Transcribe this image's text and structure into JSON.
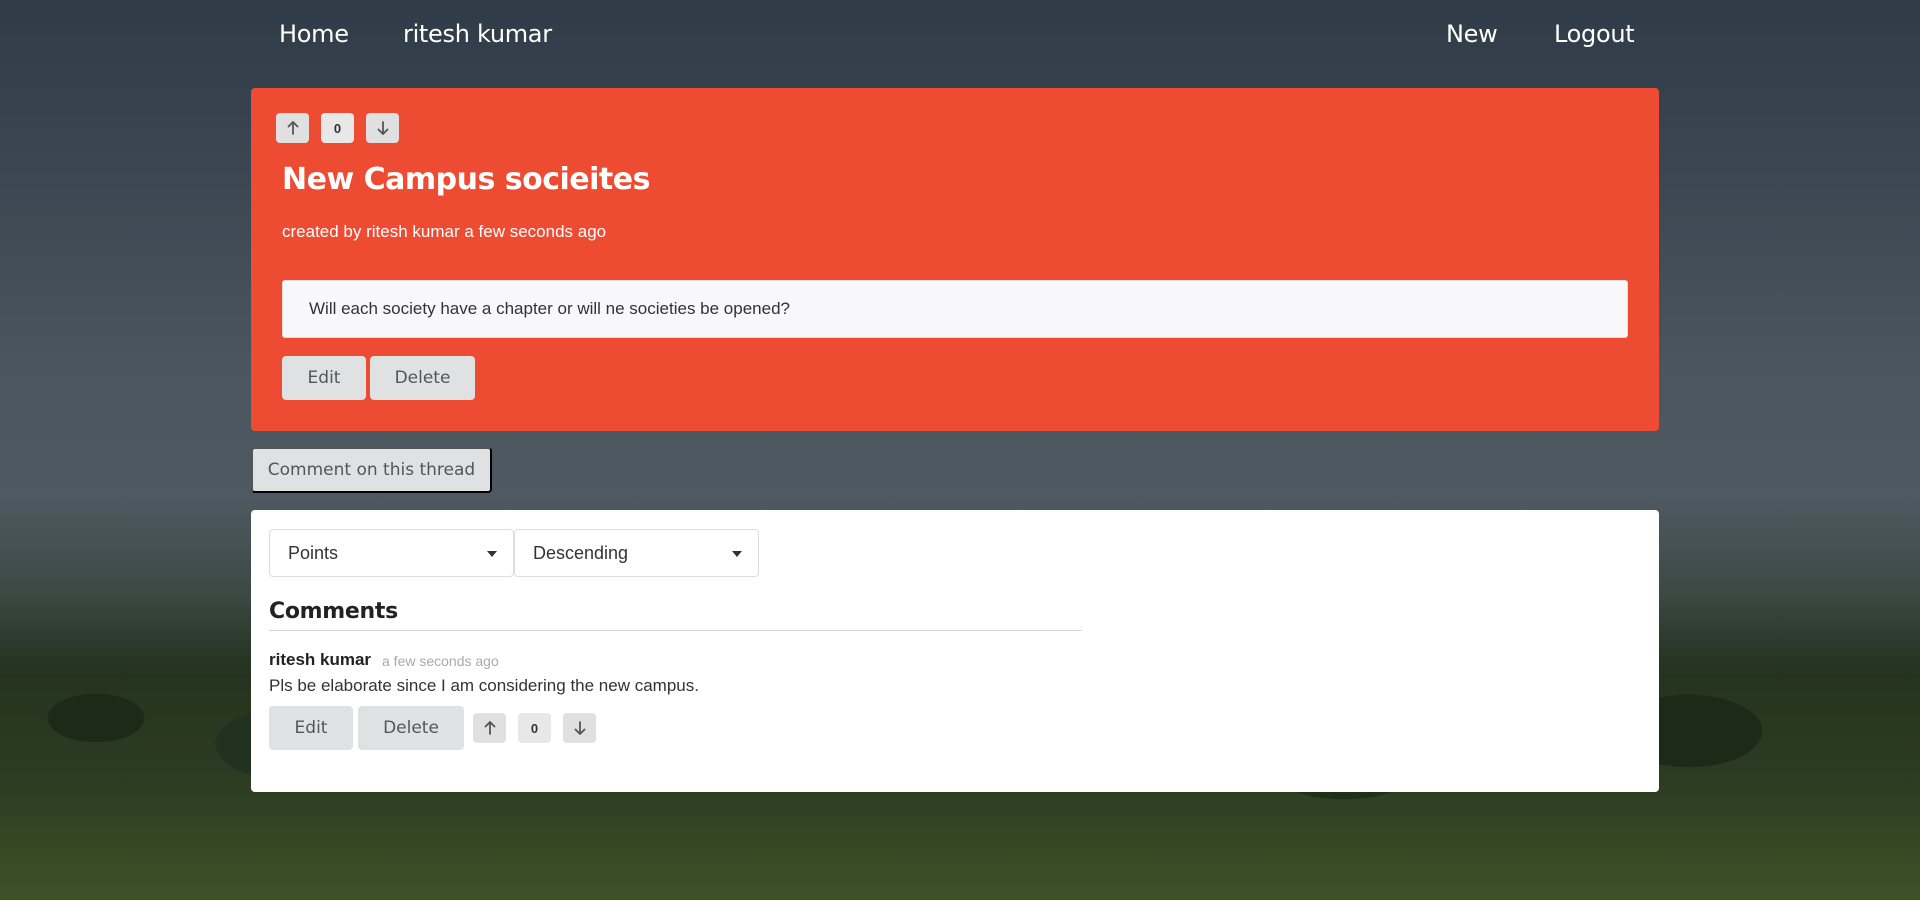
{
  "nav": {
    "home": "Home",
    "user": "ritesh kumar",
    "new": "New",
    "logout": "Logout"
  },
  "thread": {
    "votes": "0",
    "title": "New Campus socieites",
    "meta": "created by ritesh kumar a few seconds ago",
    "body": "Will each society have a chapter or will ne societies be opened?",
    "edit_label": "Edit",
    "delete_label": "Delete",
    "accent_color": "#ee4b33"
  },
  "comment_button": "Comment on this thread",
  "sort": {
    "field": "Points",
    "order": "Descending"
  },
  "comments": {
    "heading": "Comments",
    "items": [
      {
        "author": "ritesh kumar",
        "time": "a few seconds ago",
        "text": "Pls be elaborate since I am considering the new campus.",
        "votes": "0",
        "edit_label": "Edit",
        "delete_label": "Delete"
      }
    ]
  },
  "icons": {
    "upvote": "arrow-up-icon",
    "downvote": "arrow-down-icon",
    "dropdown": "caret-down-icon"
  }
}
